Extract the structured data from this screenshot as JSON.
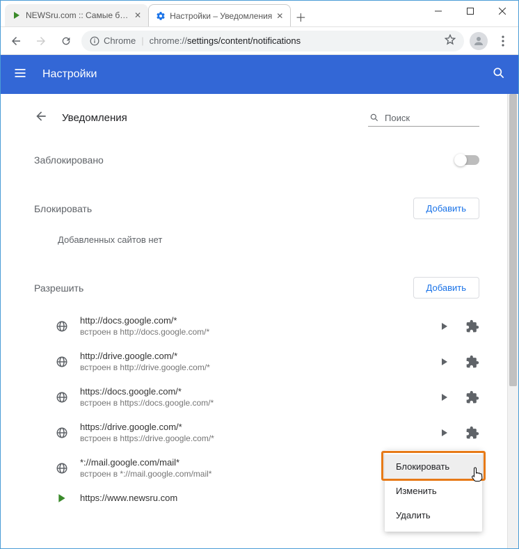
{
  "window": {
    "tabs": [
      {
        "title": "NEWSru.com :: Самые быстрые",
        "active": false
      },
      {
        "title": "Настройки – Уведомления",
        "active": true
      }
    ]
  },
  "omnibox": {
    "secure_label": "Chrome",
    "url_prefix": "chrome://",
    "url_path": "settings/content/notifications"
  },
  "header": {
    "title": "Настройки"
  },
  "page": {
    "back_title": "Уведомления",
    "search_placeholder": "Поиск",
    "blocked_label": "Заблокировано",
    "block_section": {
      "title": "Блокировать",
      "add_label": "Добавить",
      "empty": "Добавленных сайтов нет"
    },
    "allow_section": {
      "title": "Разрешить",
      "add_label": "Добавить",
      "sites": [
        {
          "url": "http://docs.google.com/*",
          "sub": "встроен в http://docs.google.com/*",
          "icon": "globe"
        },
        {
          "url": "http://drive.google.com/*",
          "sub": "встроен в http://drive.google.com/*",
          "icon": "globe"
        },
        {
          "url": "https://docs.google.com/*",
          "sub": "встроен в https://docs.google.com/*",
          "icon": "globe"
        },
        {
          "url": "https://drive.google.com/*",
          "sub": "встроен в https://drive.google.com/*",
          "icon": "globe"
        },
        {
          "url": "*://mail.google.com/mail*",
          "sub": "встроен в *://mail.google.com/mail*",
          "icon": "globe"
        },
        {
          "url": "https://www.newsru.com",
          "sub": "",
          "icon": "newsru"
        }
      ]
    }
  },
  "context_menu": {
    "items": [
      "Блокировать",
      "Изменить",
      "Удалить"
    ]
  }
}
